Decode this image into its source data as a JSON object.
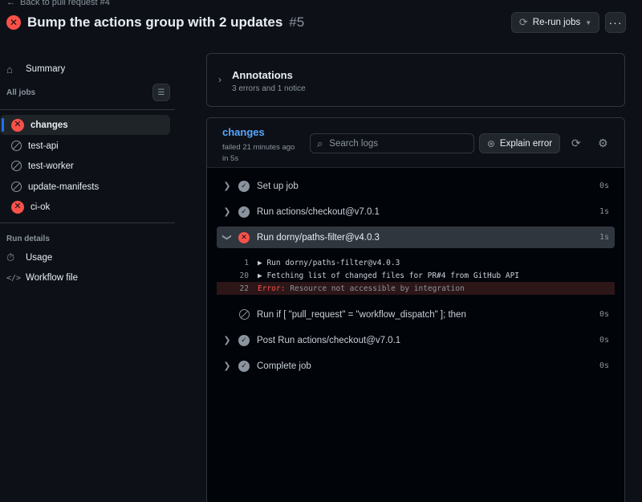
{
  "header": {
    "back_label": "Back to pull request #4",
    "title": "Bump the actions group with 2 updates",
    "run_number": "#5",
    "rerun_label": "Re-run jobs",
    "more_label": "···"
  },
  "sidebar": {
    "summary_label": "Summary",
    "all_jobs_label": "All jobs",
    "jobs": [
      {
        "label": "changes",
        "status": "failed"
      },
      {
        "label": "test-api",
        "status": "skipped"
      },
      {
        "label": "test-worker",
        "status": "skipped"
      },
      {
        "label": "update-manifests",
        "status": "skipped"
      },
      {
        "label": "ci-ok",
        "status": "failed"
      }
    ],
    "run_details_label": "Run details",
    "usage_label": "Usage",
    "workflow_file_label": "Workflow file"
  },
  "annotations": {
    "title": "Annotations",
    "summary": "3 errors and 1 notice"
  },
  "job": {
    "name": "changes",
    "status_line": "failed 21 minutes ago",
    "duration_line": "in 5s",
    "search_placeholder": "Search logs",
    "explain_label": "Explain error",
    "steps": [
      {
        "name": "Set up job",
        "time": "0s",
        "status": "success"
      },
      {
        "name": "Run actions/checkout@v7.0.1",
        "time": "1s",
        "status": "success"
      },
      {
        "name": "Run dorny/paths-filter@v4.0.3",
        "time": "1s",
        "status": "failed"
      },
      {
        "name": "Run if [ \"pull_request\" = \"workflow_dispatch\" ]; then",
        "time": "0s",
        "status": "skipped"
      },
      {
        "name": "Post Run actions/checkout@v7.0.1",
        "time": "0s",
        "status": "success"
      },
      {
        "name": "Complete job",
        "time": "0s",
        "status": "success"
      }
    ],
    "log_lines": [
      {
        "num": "1",
        "text": "▶ Run dorny/paths-filter@v4.0.3"
      },
      {
        "num": "20",
        "text": "▶ Fetching list of changed files for PR#4 from GitHub API"
      },
      {
        "num": "22",
        "error_prefix": "Error:",
        "text": "Resource not accessible by integration"
      }
    ]
  },
  "colors": {
    "background": "#0d1117",
    "accent": "#58a6ff",
    "error": "#f85149",
    "border": "#30363d"
  }
}
